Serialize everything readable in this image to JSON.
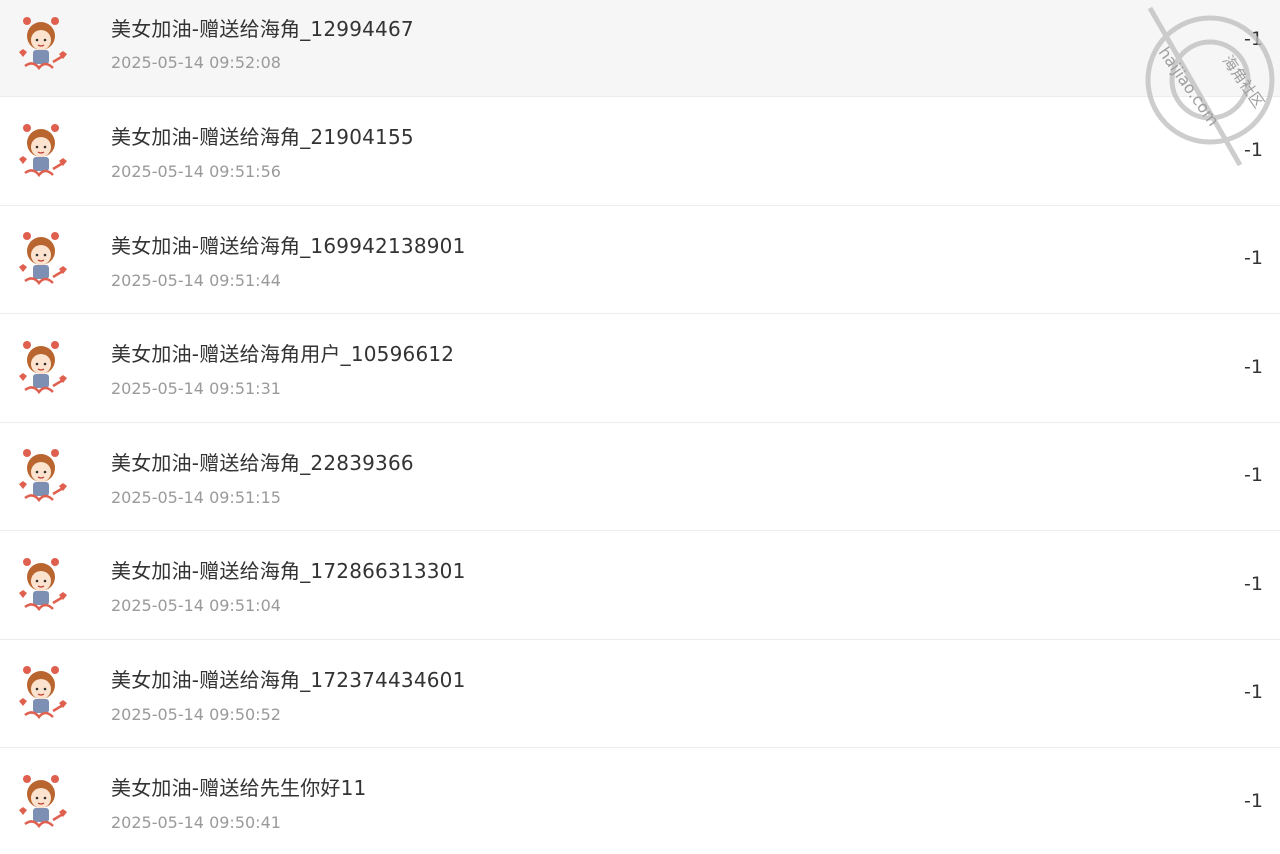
{
  "watermark": {
    "site_cn": "海角社区",
    "site_url": "haijiao.com"
  },
  "records": [
    {
      "title": "美女加油-赠送给海角_12994467",
      "time": "2025-05-14 09:52:08",
      "amount": "-1"
    },
    {
      "title": "美女加油-赠送给海角_21904155",
      "time": "2025-05-14 09:51:56",
      "amount": "-1"
    },
    {
      "title": "美女加油-赠送给海角_169942138901",
      "time": "2025-05-14 09:51:44",
      "amount": "-1"
    },
    {
      "title": "美女加油-赠送给海角用户_10596612",
      "time": "2025-05-14 09:51:31",
      "amount": "-1"
    },
    {
      "title": "美女加油-赠送给海角_22839366",
      "time": "2025-05-14 09:51:15",
      "amount": "-1"
    },
    {
      "title": "美女加油-赠送给海角_172866313301",
      "time": "2025-05-14 09:51:04",
      "amount": "-1"
    },
    {
      "title": "美女加油-赠送给海角_172374434601",
      "time": "2025-05-14 09:50:52",
      "amount": "-1"
    },
    {
      "title": "美女加油-赠送给先生你好11",
      "time": "2025-05-14 09:50:41",
      "amount": "-1"
    }
  ],
  "colors": {
    "title": "#333333",
    "time": "#9a9a9a",
    "first_row_bg": "#f6f6f6",
    "divider": "#ececec"
  }
}
